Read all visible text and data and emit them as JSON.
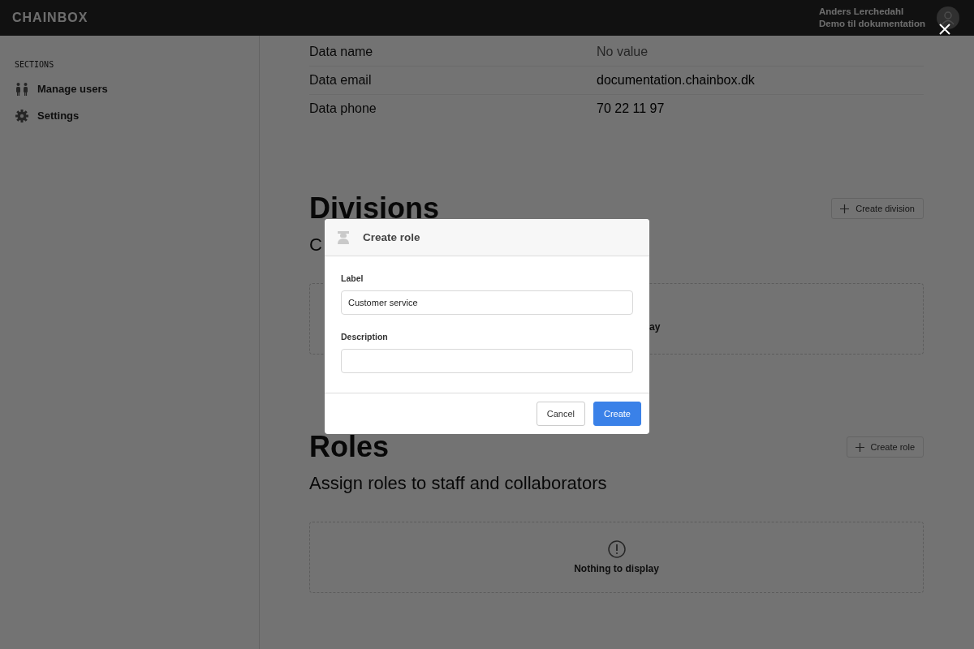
{
  "topbar": {
    "logo": "CHAINBOX",
    "user_name": "Anders Lerchedahl",
    "user_org": "Demo til dokumentation"
  },
  "sidebar": {
    "heading": "SECTIONS",
    "items": [
      {
        "label": "Manage users",
        "kind": "users"
      },
      {
        "label": "Settings",
        "kind": "gear"
      }
    ]
  },
  "details": [
    {
      "label": "Data name",
      "value": "No value",
      "empty": true
    },
    {
      "label": "Data email",
      "value": "documentation.chainbox.dk",
      "empty": false
    },
    {
      "label": "Data phone",
      "value": "70 22 11 97",
      "empty": false
    }
  ],
  "sections": [
    {
      "title": "Divisions",
      "subtitle": "C",
      "button": "Create division",
      "empty_text": "ay",
      "covered": true
    },
    {
      "title": "Roles",
      "subtitle": "Assign roles to staff and collaborators",
      "button": "Create role",
      "empty_text": "Nothing to display",
      "covered": false
    }
  ],
  "modal": {
    "title": "Create role",
    "fields": [
      {
        "label": "Label",
        "value": "Customer service"
      },
      {
        "label": "Description"
      }
    ],
    "buttons": [
      {
        "label": "Cancel",
        "kind": "secondary"
      },
      {
        "label": "Create",
        "kind": "primary"
      }
    ]
  }
}
